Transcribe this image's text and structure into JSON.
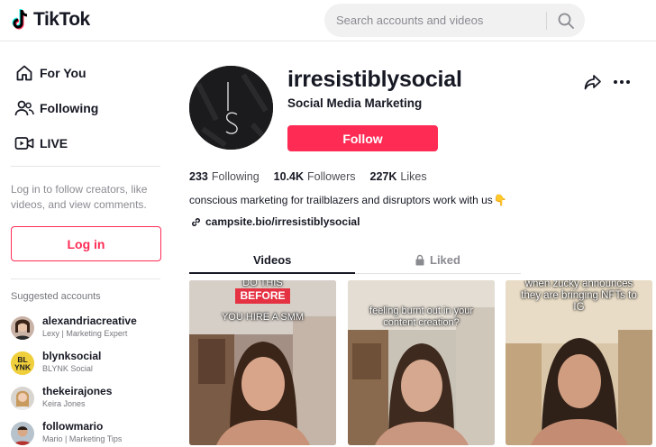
{
  "header": {
    "logo_text": "TikTok",
    "search_placeholder": "Search accounts and videos"
  },
  "sidebar": {
    "nav": [
      {
        "label": "For You",
        "icon": "home-icon"
      },
      {
        "label": "Following",
        "icon": "following-users-icon"
      },
      {
        "label": "LIVE",
        "icon": "live-camera-icon"
      }
    ],
    "login_hint": "Log in to follow creators, like videos, and view comments.",
    "login_label": "Log in",
    "suggested_title": "Suggested accounts",
    "suggested": [
      {
        "username": "alexandriacreative",
        "sub": "Lexy | Marketing Expert"
      },
      {
        "username": "blynksocial",
        "sub": "BLYNK Social",
        "avatar_text": "BL YNK"
      },
      {
        "username": "thekeirajones",
        "sub": "Keira Jones"
      },
      {
        "username": "followmario",
        "sub": "Mario | Marketing Tips"
      }
    ]
  },
  "profile": {
    "avatar_text": "I S",
    "username": "irresistiblysocial",
    "nickname": "Social Media Marketing",
    "follow_label": "Follow",
    "stats": [
      {
        "value": "233",
        "label": "Following"
      },
      {
        "value": "10.4K",
        "label": "Followers"
      },
      {
        "value": "227K",
        "label": "Likes"
      }
    ],
    "bio": "conscious marketing for trailblazers and disruptors work with us",
    "bio_emoji": "👇",
    "link": "campsite.bio/irresistiblysocial"
  },
  "tabs": {
    "videos_label": "Videos",
    "liked_label": "Liked"
  },
  "videos": [
    {
      "top_caption": "DO THIS",
      "badge": "BEFORE",
      "caption": "YOU HIRE A SMM"
    },
    {
      "caption": "feeling burnt out in your content creation?"
    },
    {
      "caption": "when zucky announces they are bringing NFTs to IG"
    }
  ],
  "colors": {
    "accent": "#fe2c55",
    "text": "#161823",
    "muted": "#8a8b91"
  }
}
